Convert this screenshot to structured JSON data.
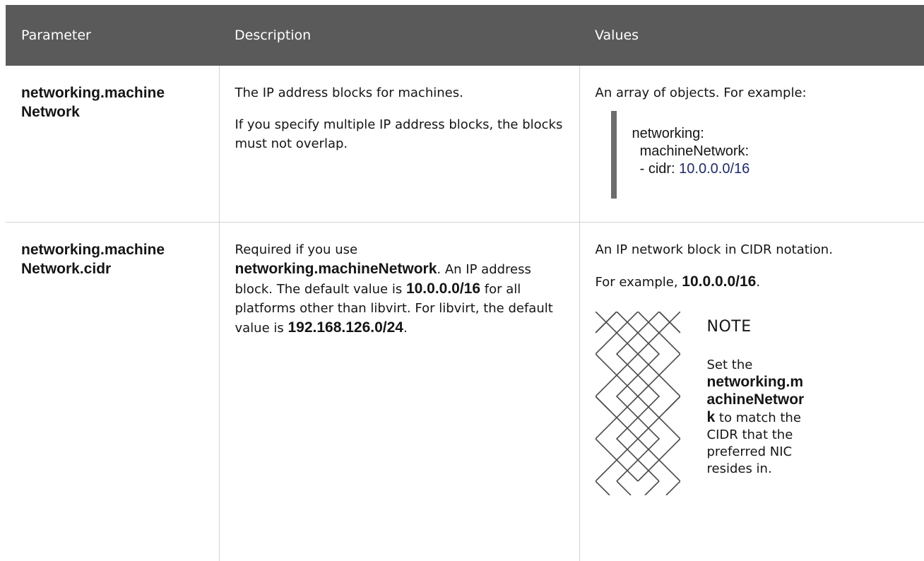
{
  "table": {
    "headers": [
      "Parameter",
      "Description",
      "Values"
    ],
    "rows": [
      {
        "parameter": {
          "line1": "networking.machine",
          "line2": "Network"
        },
        "description": {
          "p1": "The IP address blocks for machines.",
          "p2": "If you specify multiple IP address blocks, the blocks must not overlap."
        },
        "values": {
          "intro": "An array of objects. For example:",
          "code": {
            "line1": "networking:",
            "line2": "  machineNetwork:",
            "line3_prefix": "  - cidr: ",
            "line3_value": "10.0.0.0/16"
          }
        }
      },
      {
        "parameter": {
          "line1": "networking.machine",
          "line2": "Network.cidr"
        },
        "description": {
          "text1": "Required if you use ",
          "bold1": "networking.machineNetwork",
          "text2": ". An IP address block. The default value is ",
          "bold2": "10.0.0.0/16",
          "text3": " for all platforms other than libvirt. For libvirt, the default value is ",
          "bold3": "192.168.126.0/24",
          "text4": "."
        },
        "values": {
          "p1": "An IP network block in CIDR notation.",
          "p2_text": "For example, ",
          "p2_bold": "10.0.0.0/16",
          "p2_end": ".",
          "note": {
            "title": "NOTE",
            "text1": "Set the ",
            "bold": "networking.machineNetwork",
            "text2": " to match the CIDR that the preferred NIC resides in."
          }
        }
      }
    ]
  }
}
